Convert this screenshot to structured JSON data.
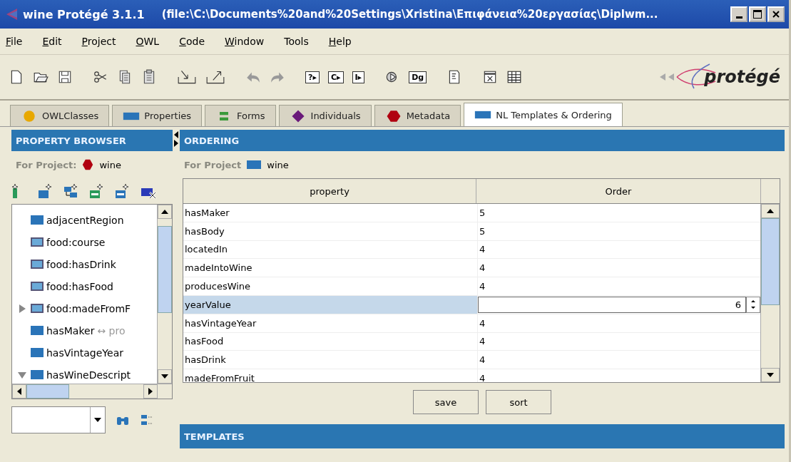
{
  "window": {
    "title": "wine  Protégé 3.1.1",
    "path": "(file:\\C:\\Documents%20and%20Settings\\Xristina\\Επιφάνεια%20εργασίας\\Diplwm..."
  },
  "menu": [
    {
      "label": "File",
      "underlined": true
    },
    {
      "label": "Edit",
      "underlined": true
    },
    {
      "label": "Project",
      "underlined": true
    },
    {
      "label": "OWL",
      "underlined": true
    },
    {
      "label": "Code",
      "underlined": true
    },
    {
      "label": "Window",
      "underlined": true
    },
    {
      "label": "Tools",
      "underlined": false
    },
    {
      "label": "Help",
      "underlined": true
    }
  ],
  "toolbar": [
    {
      "kind": "new"
    },
    {
      "kind": "open"
    },
    {
      "kind": "save"
    },
    {
      "kind": "sep"
    },
    {
      "kind": "cut"
    },
    {
      "kind": "copy"
    },
    {
      "kind": "paste"
    },
    {
      "kind": "sep"
    },
    {
      "kind": "import"
    },
    {
      "kind": "export"
    },
    {
      "kind": "sep"
    },
    {
      "kind": "undo"
    },
    {
      "kind": "redo"
    },
    {
      "kind": "sep"
    },
    {
      "kind": "glyph",
      "glyph": "?▸"
    },
    {
      "kind": "glyph",
      "glyph": "C▸"
    },
    {
      "kind": "glyph",
      "glyph": "I▸"
    },
    {
      "kind": "sep"
    },
    {
      "kind": "gear"
    },
    {
      "kind": "glyph",
      "glyph": "Dg"
    },
    {
      "kind": "sep"
    },
    {
      "kind": "doc"
    },
    {
      "kind": "sep"
    },
    {
      "kind": "frame"
    },
    {
      "kind": "grid"
    }
  ],
  "logo": "protégé",
  "tabs": [
    {
      "label": "OWLClasses",
      "kind": "circle",
      "color": "#e8a800",
      "selected": false
    },
    {
      "label": "Properties",
      "kind": "rect",
      "color": "#2a74b8",
      "selected": false
    },
    {
      "label": "Forms",
      "kind": "lines",
      "color": "#3a9a3a",
      "selected": false
    },
    {
      "label": "Individuals",
      "kind": "diamond",
      "color": "#6a1a7a",
      "selected": false
    },
    {
      "label": "Metadata",
      "kind": "hexagon",
      "color": "#b00010",
      "selected": false
    },
    {
      "label": "NL Templates & Ordering",
      "kind": "rect",
      "color": "#2a74b8",
      "selected": true
    }
  ],
  "browser": {
    "title": "PROPERTY BROWSER",
    "project_label": "For Project:",
    "project": "wine",
    "tree": [
      {
        "label": "adjacentRegion",
        "kind": "object"
      },
      {
        "label": "food:course",
        "kind": "imported"
      },
      {
        "label": "food:hasDrink",
        "kind": "imported"
      },
      {
        "label": "food:hasFood",
        "kind": "imported"
      },
      {
        "label": "food:madeFromF",
        "kind": "imported",
        "expanded": false
      },
      {
        "label": "hasMaker",
        "suffix": "↔ pro",
        "kind": "object"
      },
      {
        "label": "hasVintageYear",
        "kind": "object"
      },
      {
        "label": "hasWineDescript",
        "kind": "object",
        "expanded": true
      }
    ]
  },
  "ordering": {
    "title": "ORDERING",
    "project_label": "For Project",
    "project": "wine",
    "columns": [
      "property",
      "Order"
    ],
    "rows": [
      {
        "property": "hasMaker",
        "order": "5",
        "selected": false
      },
      {
        "property": "hasBody",
        "order": "5",
        "selected": false
      },
      {
        "property": "locatedIn",
        "order": "4",
        "selected": false
      },
      {
        "property": "madeIntoWine",
        "order": "4",
        "selected": false
      },
      {
        "property": "producesWine",
        "order": "4",
        "selected": false
      },
      {
        "property": "yearValue",
        "order": "6",
        "selected": true
      },
      {
        "property": "hasVintageYear",
        "order": "4",
        "selected": false
      },
      {
        "property": "hasFood",
        "order": "4",
        "selected": false
      },
      {
        "property": "hasDrink",
        "order": "4",
        "selected": false
      },
      {
        "property": "madeFromFruit",
        "order": "4",
        "selected": false
      }
    ],
    "buttons": [
      "save",
      "sort"
    ]
  },
  "templates": {
    "title": "TEMPLATES"
  }
}
